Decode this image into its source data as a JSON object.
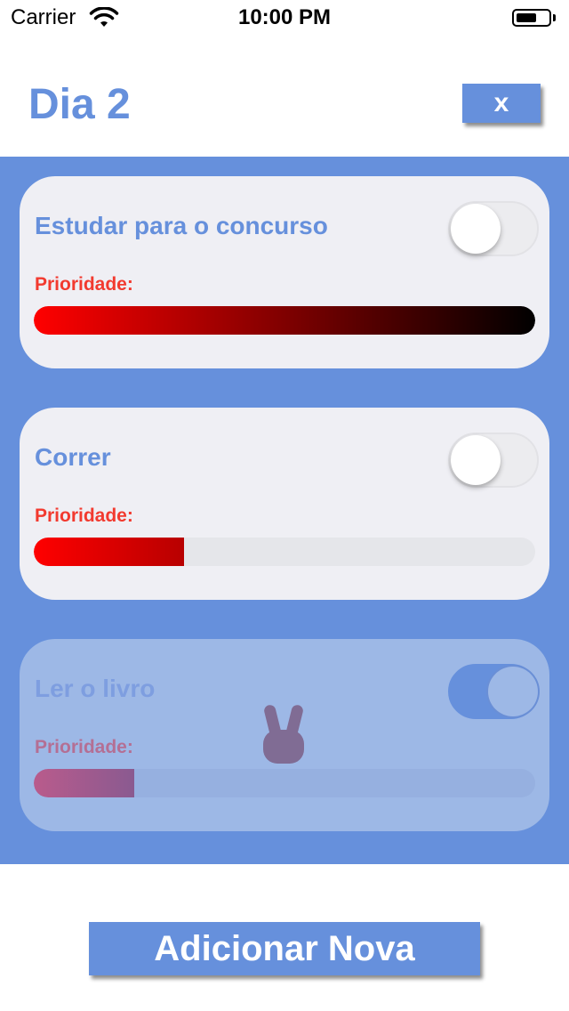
{
  "status_bar": {
    "carrier": "Carrier",
    "time": "10:00 PM",
    "wifi_icon": "wifi-icon",
    "battery_icon": "battery-icon"
  },
  "header": {
    "title": "Dia 2",
    "close_label": "x"
  },
  "tasks": [
    {
      "title": "Estudar para o concurso",
      "toggle_on": false,
      "priority_label": "Prioridade:",
      "priority_level": 1.0
    },
    {
      "title": "Correr",
      "toggle_on": false,
      "priority_label": "Prioridade:",
      "priority_level": 0.3
    },
    {
      "title": "Ler o livro",
      "toggle_on": true,
      "priority_label": "Prioridade:",
      "priority_level": 0.2
    }
  ],
  "drag_icon": "peace-hand-icon",
  "add_button_label": "Adicionar Nova",
  "colors": {
    "accent": "#6690dc",
    "priority_red": "#f23a2f",
    "card_bg": "#efeff4"
  }
}
